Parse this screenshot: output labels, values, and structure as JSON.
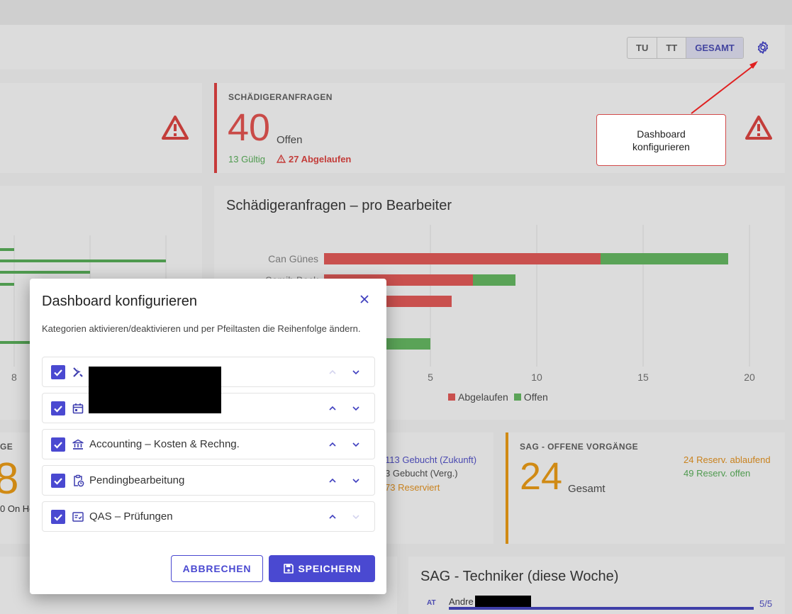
{
  "toolbar": {
    "segments": [
      "TU",
      "TT",
      "GESAMT"
    ],
    "settings_icon": "gear-icon"
  },
  "kpi_schaediger": {
    "title": "SCHÄDIGERANFRAGEN",
    "value": "40",
    "value_label": "Offen",
    "valid": "13 Gültig",
    "expired": "27 Abgelaufen",
    "colors": {
      "accent": "#c73a3a",
      "valid": "#4f9a4f"
    }
  },
  "callout": {
    "text": "Dashboard konfigurieren"
  },
  "chart_left": {
    "tick": "8"
  },
  "chart_right": {
    "title": "Schädigeranfragen – pro Bearbeiter",
    "chart_data": {
      "type": "bar",
      "orientation": "horizontal",
      "stacked": true,
      "categories": [
        "Can Günes",
        "Samih Bock",
        "",
        "",
        ""
      ],
      "series": [
        {
          "name": "Abgelaufen",
          "color": "#c9504e",
          "values": [
            13,
            7,
            6,
            0,
            0
          ]
        },
        {
          "name": "Offen",
          "color": "#5aa357",
          "values": [
            6,
            2,
            0,
            0,
            5
          ]
        }
      ],
      "xlim": [
        0,
        20
      ],
      "xticks": [
        "5",
        "10",
        "15",
        "20"
      ],
      "legend": [
        "Abgelaufen",
        "Offen"
      ]
    }
  },
  "kpi_left_bottom": {
    "title_fragment": "GE",
    "value_fragment": "8",
    "sub_fragment": "0 On Ho"
  },
  "kpi_middle_bottom": {
    "line1": "113 Gebucht (Zukunft)",
    "line2": "3 Gebucht (Verg.)",
    "line3": "73 Reserviert"
  },
  "kpi_sag": {
    "title": "SAG - OFFENE VORGÄNGE",
    "value": "24",
    "value_label": "Gesamt",
    "line1": "24 Reserv. ablaufend",
    "line2": "49 Reserv. offen"
  },
  "sag_techniker": {
    "title": "SAG - Techniker (diese Woche)",
    "badge": "AT",
    "name": "Andre",
    "count": "5/5"
  },
  "modal": {
    "title": "Dashboard konfigurieren",
    "description": "Kategorien aktivieren/deaktivieren und per Pfeiltasten die Reihenfolge ändern.",
    "rows": [
      {
        "icon": "tools-icon",
        "label": "",
        "checked": true,
        "up_enabled": false,
        "down_enabled": true
      },
      {
        "icon": "calendar-icon",
        "label": "",
        "checked": true,
        "up_enabled": true,
        "down_enabled": true
      },
      {
        "icon": "bank-icon",
        "label": "Accounting – Kosten & Rechng.",
        "checked": true,
        "up_enabled": true,
        "down_enabled": true
      },
      {
        "icon": "clipboard-clock-icon",
        "label": "Pendingbearbeitung",
        "checked": true,
        "up_enabled": true,
        "down_enabled": true
      },
      {
        "icon": "checklist-icon",
        "label": "QAS – Prüfungen",
        "checked": true,
        "up_enabled": true,
        "down_enabled": false
      }
    ],
    "cancel_label": "ABBRECHEN",
    "save_label": "SPEICHERN",
    "accent": "#4a49d1"
  }
}
